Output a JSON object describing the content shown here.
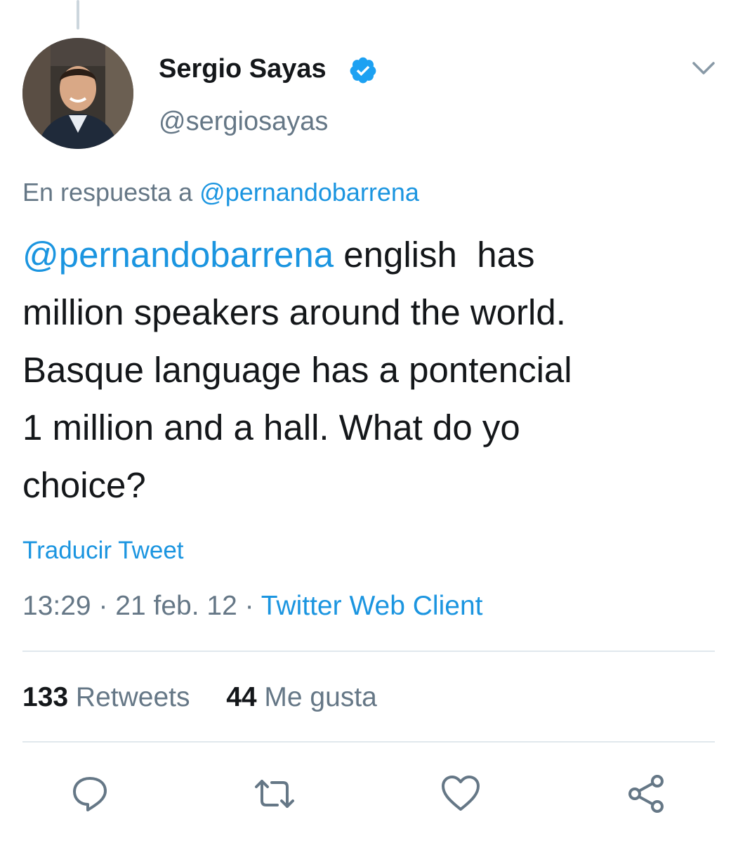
{
  "tweet": {
    "display_name": "Sergio Sayas",
    "handle": "@sergiosayas",
    "reply_prefix": "En respuesta a",
    "reply_to": "@pernandobarrena",
    "mention": "@pernandobarrena",
    "text_body": " english  has\nmillion speakers around the world.\nBasque language has a pontencial\n1 million and a hall. What do yo\nchoice?",
    "translate_label": "Traducir Tweet",
    "time": "13:29",
    "date": "21 feb. 12",
    "separator": "·",
    "source": "Twitter Web Client"
  },
  "stats": {
    "retweets_count": "133",
    "retweets_label": "Retweets",
    "likes_count": "44",
    "likes_label": "Me gusta"
  },
  "icons": {
    "verified": "verified-badge-icon",
    "caret": "chevron-down-icon",
    "reply": "reply-icon",
    "retweet": "retweet-icon",
    "like": "heart-icon",
    "share": "share-icon"
  },
  "colors": {
    "link": "#1b95e0",
    "muted": "#657786",
    "text": "#14171a",
    "divider": "#e1e8ed"
  }
}
